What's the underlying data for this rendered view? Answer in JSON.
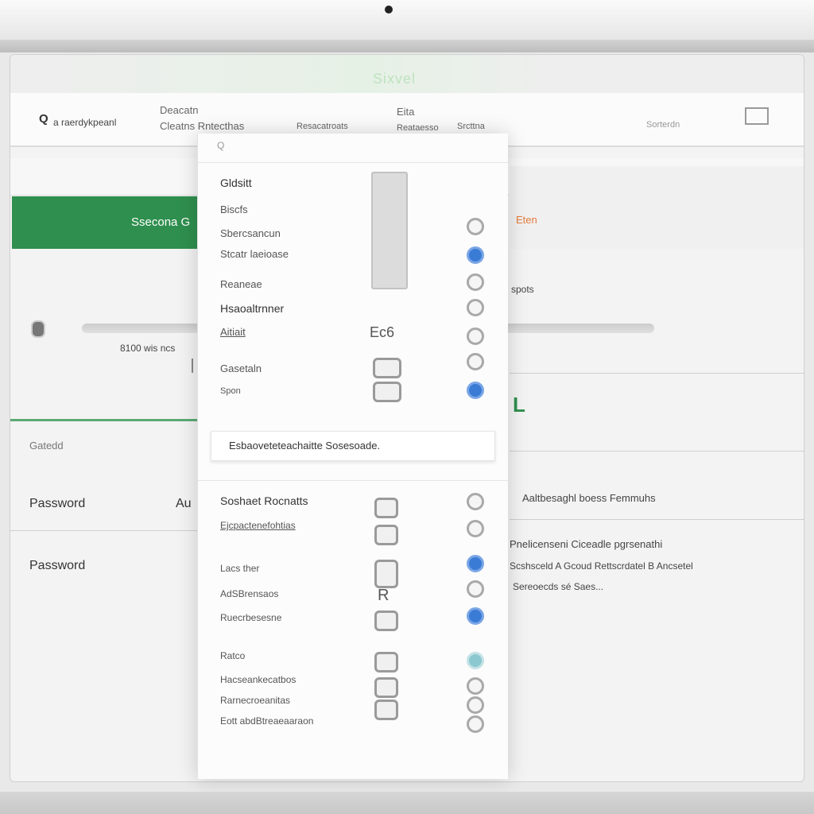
{
  "window": {
    "title": "Sixvel"
  },
  "nav": {
    "brand_icon": "Q",
    "brand_text": "a raerdykpeanl",
    "links": [
      "Deacatn",
      "Cleatns Rntecthas",
      "Resacatroats",
      "Eita",
      "Reataesso",
      "Srcttna",
      "Sorterdn"
    ]
  },
  "left": {
    "banner": "Ssecona G",
    "meta1": "8100 wis ncs",
    "field_label": "Gatedd",
    "password1": "Password",
    "password1_value": "Au",
    "password2": "Password"
  },
  "right": {
    "warning": "Eten",
    "spots": "spots",
    "big_letter": "L",
    "hint": "Aaltbesaghl boess Femmuhs",
    "info_lines": [
      "Pnelicenseni Ciceadle pgrsenathi",
      "Scshsceld A Gcoud Rettscrdatel B Ancsetel",
      "Sereoecds sé Saes..."
    ]
  },
  "panel": {
    "search_placeholder": "Q",
    "top_items": [
      {
        "label": "Gldsitt",
        "icon": "settings-icon"
      },
      {
        "label": "Biscfs",
        "icon": "list-icon"
      },
      {
        "label": "Sbercsancun",
        "icon": "circle-icon"
      },
      {
        "label": "Stcatr laeioase",
        "icon": "toggle-blue-icon"
      },
      {
        "label": "Reaneae",
        "icon": "clock-icon"
      },
      {
        "label": "Hsaoaltrnner",
        "icon": "lock-icon"
      },
      {
        "label": "Aitiait",
        "icon": "mail-icon",
        "code": "Ec6"
      },
      {
        "label": "Gasetaln",
        "icon": "leaf-icon"
      },
      {
        "label": "Spon",
        "icon": "info-blue-icon"
      }
    ],
    "mid_input": "Esbaoveteteachaitte Sosesoade.",
    "bottom_header": "Soshaet Rocnatts",
    "bottom_items": [
      {
        "label": "Ejcpactenefohtias",
        "icon": "refresh-icon"
      },
      {
        "label": "Lacs ther",
        "icon": "check-blue-icon"
      },
      {
        "label": "AdSBrensaos",
        "icon": "gear-icon",
        "code": "R"
      },
      {
        "label": "Ruecrbesesne",
        "icon": "flag-blue-icon"
      },
      {
        "label": "Ratco",
        "icon": "teal-icon"
      },
      {
        "label": "Hacseankecatbos",
        "icon": "key-icon"
      },
      {
        "label": "Rarnecroeanitas",
        "icon": "user-icon"
      },
      {
        "label": "Eott abdBtreaeaaraon",
        "icon": "dot-icon"
      }
    ]
  }
}
